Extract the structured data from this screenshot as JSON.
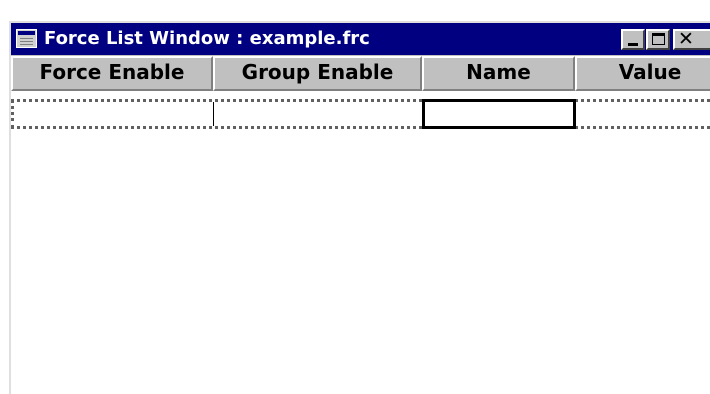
{
  "window": {
    "title": "Force List Window : example.frc",
    "controls": {
      "minimize_label": "_",
      "close_label": "✕"
    }
  },
  "table": {
    "columns": [
      "Force Enable",
      "Group Enable",
      "Name",
      "Value"
    ],
    "rows": [
      {
        "force_enable": "",
        "group_enable": "",
        "name": "",
        "value": ""
      }
    ]
  },
  "colors": {
    "titlebar": "#000080",
    "chrome": "#c0c0c0",
    "body": "#ffffff"
  },
  "icons": {
    "system": "window-icon",
    "minimize": "minimize-icon",
    "maximize": "maximize-icon",
    "close": "close-icon"
  }
}
